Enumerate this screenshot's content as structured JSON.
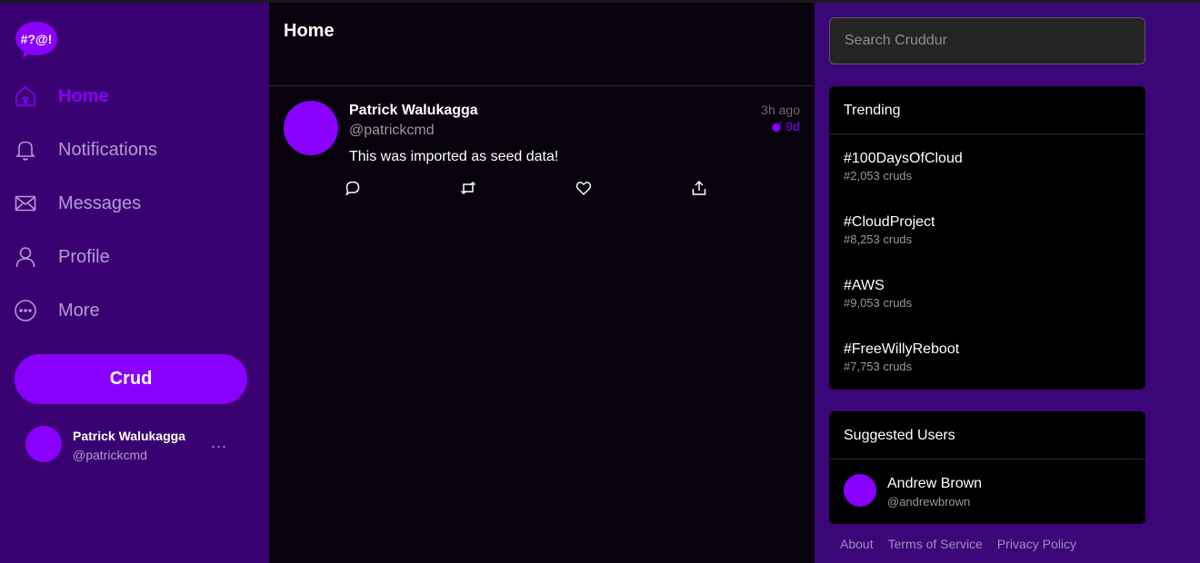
{
  "brand": {
    "logo_text": "#?@!",
    "accent": "#8a00ff",
    "sidebar_bg": "#380070"
  },
  "nav": [
    {
      "label": "Home",
      "icon": "home-icon",
      "active": true
    },
    {
      "label": "Notifications",
      "icon": "bell-icon",
      "active": false
    },
    {
      "label": "Messages",
      "icon": "envelope-icon",
      "active": false
    },
    {
      "label": "Profile",
      "icon": "user-icon",
      "active": false
    },
    {
      "label": "More",
      "icon": "more-circle-icon",
      "active": false
    }
  ],
  "compose_button": "Crud",
  "current_user": {
    "name": "Patrick Walukagga",
    "handle": "@patrickcmd",
    "more": "..."
  },
  "main": {
    "title": "Home",
    "posts": [
      {
        "author": "Patrick Walukagga",
        "handle": "@patrickcmd",
        "time": "3h ago",
        "expires": "9d",
        "body": "This was imported as seed data!",
        "actions": [
          "reply-icon",
          "repost-icon",
          "like-icon",
          "share-icon"
        ]
      }
    ]
  },
  "search": {
    "placeholder": "Search Cruddur"
  },
  "trending": {
    "title": "Trending",
    "items": [
      {
        "tag": "#100DaysOfCloud",
        "count": "#2,053 cruds"
      },
      {
        "tag": "#CloudProject",
        "count": "#8,253 cruds"
      },
      {
        "tag": "#AWS",
        "count": "#9,053 cruds"
      },
      {
        "tag": "#FreeWillyReboot",
        "count": "#7,753 cruds"
      }
    ]
  },
  "suggested": {
    "title": "Suggested Users",
    "users": [
      {
        "name": "Andrew Brown",
        "handle": "@andrewbrown"
      }
    ]
  },
  "footer": {
    "about": "About",
    "terms": "Terms of Service",
    "privacy": "Privacy Policy"
  }
}
